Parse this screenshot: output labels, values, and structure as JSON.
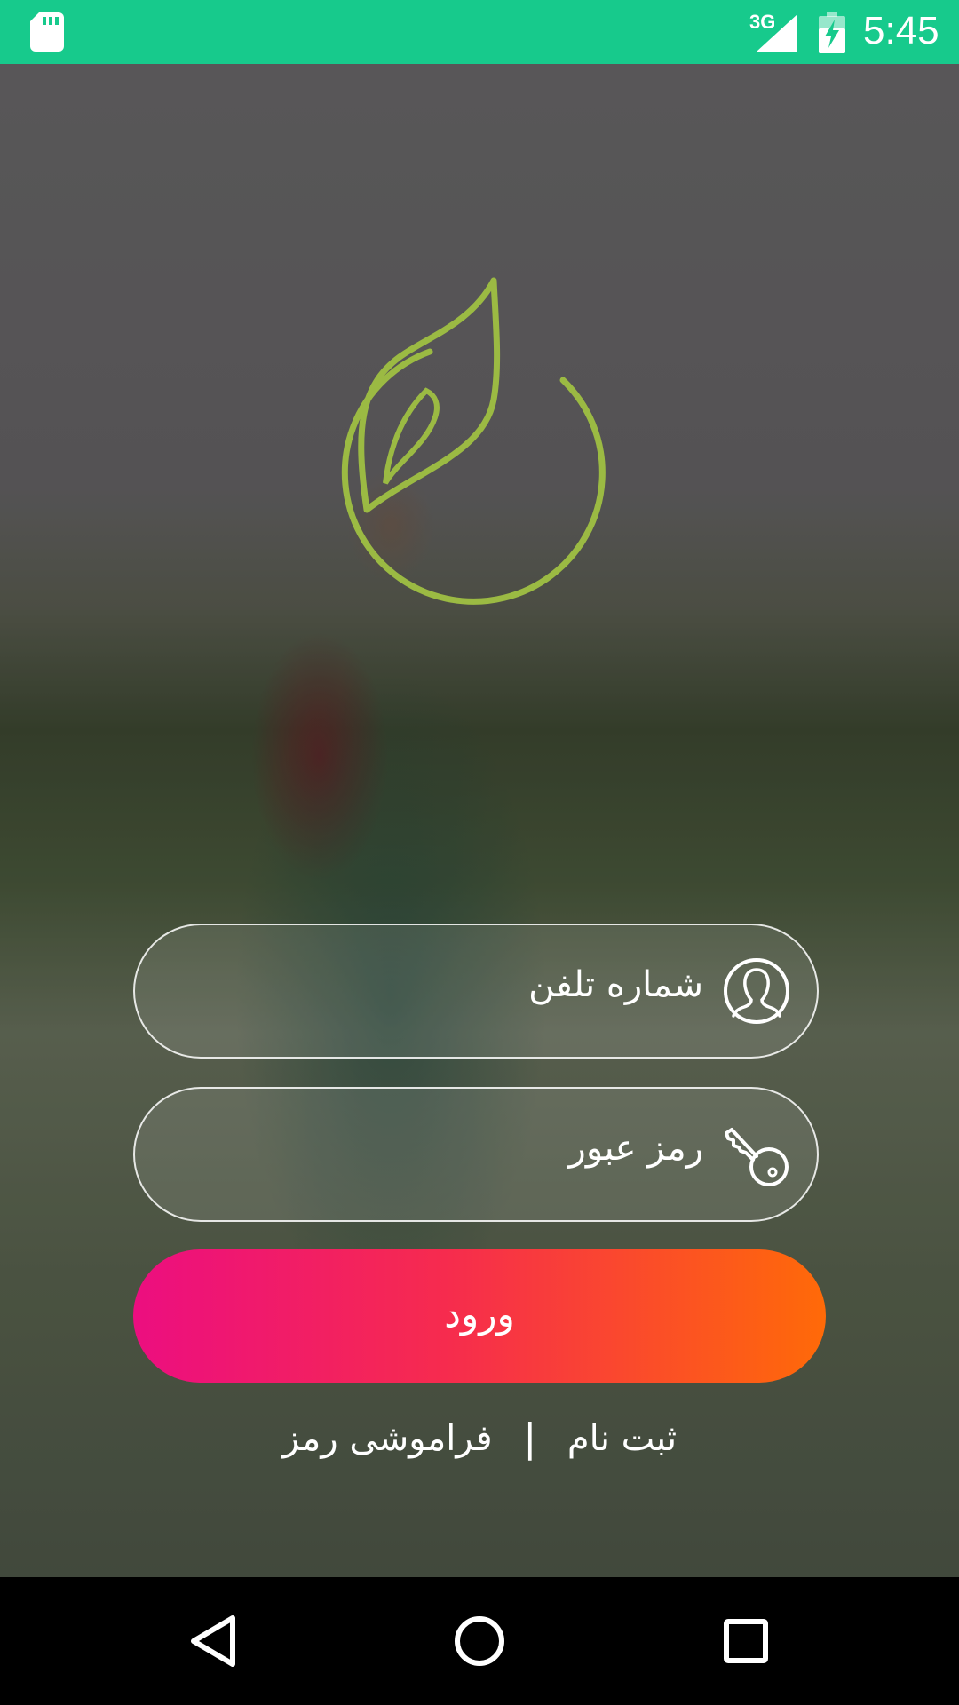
{
  "status_bar": {
    "network_type": "3G",
    "time": "5:45",
    "icons": [
      "sd-card-icon",
      "signal-icon",
      "battery-charging-icon"
    ],
    "color": "#17CA8C"
  },
  "login_form": {
    "phone_field": {
      "placeholder": "شماره تلفن",
      "icon": "user-icon"
    },
    "password_field": {
      "placeholder": "رمز عبور",
      "icon": "key-icon"
    },
    "login_button": {
      "label": "ورود",
      "gradient": [
        "#EC0E80",
        "#FF6A08"
      ]
    },
    "links": {
      "register": "ثبت نام",
      "separator": "|",
      "forgot_password": "فراموشی رمز"
    }
  },
  "logo": {
    "icon": "leaf-logo-icon",
    "color": "#9BBA43"
  },
  "nav_bar": {
    "buttons": [
      "back-icon",
      "home-icon",
      "recents-icon"
    ]
  }
}
